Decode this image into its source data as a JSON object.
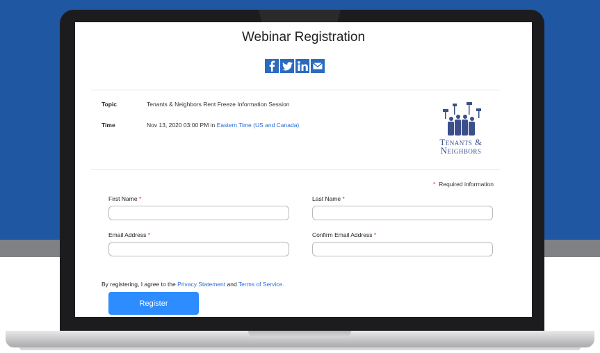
{
  "page": {
    "title": "Webinar Registration"
  },
  "share": {
    "icons": [
      "facebook-icon",
      "twitter-icon",
      "linkedin-icon",
      "email-icon"
    ]
  },
  "webinar": {
    "topic_label": "Topic",
    "topic_value": "Tenants & Neighbors Rent Freeze Information Session",
    "time_label": "Time",
    "time_value": "Nov 13, 2020 03:00 PM in",
    "timezone": "Eastern Time (US and Canada)"
  },
  "logo": {
    "line1": "Tenants &",
    "line2": "Neighbors"
  },
  "form": {
    "required_note": "Required information",
    "required_mark": "*",
    "first_name_label": "First Name",
    "last_name_label": "Last Name",
    "email_label": "Email Address",
    "confirm_email_label": "Confirm Email Address",
    "first_name_value": "",
    "last_name_value": "",
    "email_value": "",
    "confirm_email_value": ""
  },
  "agreement": {
    "prefix": "By registering, I agree to the",
    "privacy_link": "Privacy Statement",
    "and": "and",
    "terms_link": "Terms of Service."
  },
  "register": {
    "label": "Register"
  },
  "colors": {
    "background_blue": "#1f57a3",
    "accent_button": "#2d8cff",
    "link": "#2a6bd9",
    "required": "#e02828"
  }
}
